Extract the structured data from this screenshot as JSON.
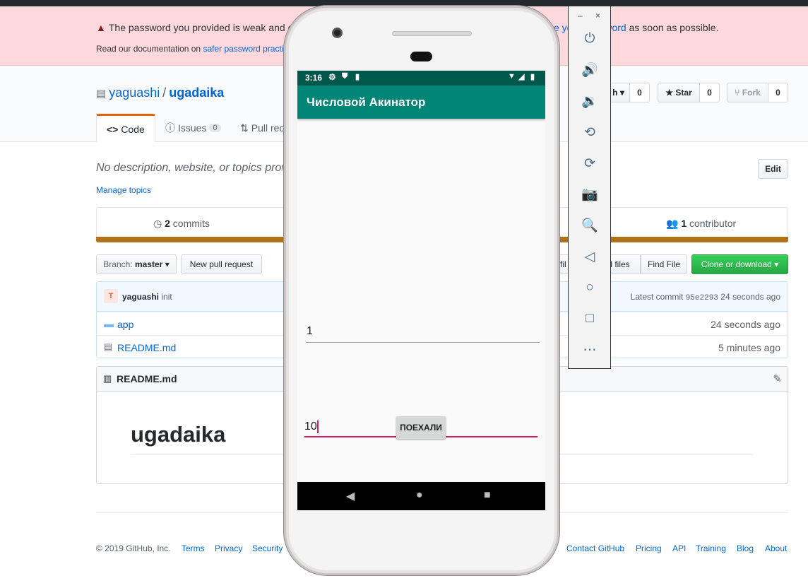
{
  "flash": {
    "line1_part1": "The password you provided is weak and c",
    "line1_link": "e your password",
    "line1_visible_link_tail": "ord",
    "line1_part2": " as soon as possible.",
    "line2_text": "Read our documentation on ",
    "line2_link": "safer password practic"
  },
  "repo": {
    "owner": "yaguashi",
    "separator": "/",
    "name": "ugadaika",
    "watch_label_tail": "h",
    "watch_count": "0",
    "star_label": "Star",
    "star_count": "0",
    "fork_label": "Fork",
    "fork_count": "0"
  },
  "tabs": [
    {
      "label": "Code"
    },
    {
      "label": "Issues",
      "count": "0"
    },
    {
      "label": "Pull rec"
    }
  ],
  "description": {
    "text": "No description, website, or topics provi",
    "edit_label": "Edit",
    "manage_topics": "Manage topics"
  },
  "summary": {
    "commits_count": "2",
    "commits_label": "commits",
    "contributors_count": "1",
    "contributors_label": "contributor"
  },
  "filebar": {
    "branch_prefix": "Branch:",
    "branch_name": "master",
    "new_pr": "New pull request",
    "create_file_tail": "fil",
    "upload_files_tail": "d files",
    "find_file": "Find File",
    "clone": "Clone or download"
  },
  "commit": {
    "author": "yaguashi",
    "message": "init",
    "latest_label": "Latest commit",
    "sha": "95e2293",
    "time": "24 seconds ago"
  },
  "files": [
    {
      "name": "app",
      "type": "folder",
      "age": "24 seconds ago"
    },
    {
      "name": "README.md",
      "type": "file",
      "age": "5 minutes ago"
    }
  ],
  "readme": {
    "filename": "README.md",
    "heading": "ugadaika"
  },
  "footer": {
    "copyright": "© 2019 GitHub, Inc.",
    "left_links": [
      "Terms",
      "Privacy",
      "Security"
    ],
    "right_links": [
      "Contact GitHub",
      "Pricing",
      "API",
      "Training",
      "Blog",
      "About"
    ]
  },
  "emulator": {
    "minimize": "–",
    "close": "×",
    "buttons": [
      "power-icon",
      "volume-up-icon",
      "volume-down-icon",
      "rotate-left-icon",
      "rotate-right-icon",
      "camera-icon",
      "zoom-icon",
      "back-icon",
      "home-icon",
      "overview-icon",
      "more-icon"
    ]
  },
  "phone": {
    "status_time": "3:16",
    "app_title": "Числовой Акинатор",
    "field1_value": "1",
    "field2_value": "10",
    "go_button": "ПОЕХАЛИ"
  },
  "colors": {
    "github_link": "#0366d6",
    "flash_bg": "#fdd9de",
    "language_bar": "#b07219",
    "clone_green": "#28a745",
    "app_status": "#00574b",
    "app_primary": "#008577",
    "accent": "#d81b60"
  }
}
